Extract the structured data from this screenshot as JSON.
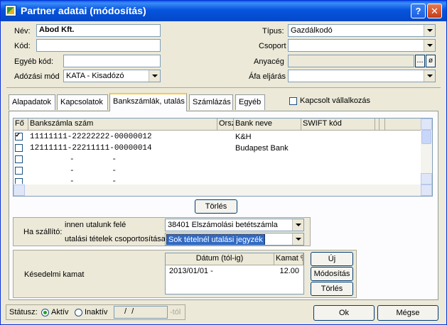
{
  "window": {
    "title": "Partner adatai (módosítás)",
    "help": "?",
    "close": "✕"
  },
  "form": {
    "nev_label": "Név:",
    "nev_value": "Abod Kft.",
    "kod_label": "Kód:",
    "kod_value": "",
    "egyeb_kod_label": "Egyéb kód:",
    "egyeb_kod_value": "",
    "adozasi_mod_label": "Adózási mód",
    "adozasi_mod_value": "KATA - Kisadózó",
    "tipus_label": "Típus:",
    "tipus_value": "Gazdálkodó",
    "csoport_label": "Csoport",
    "csoport_value": "",
    "anyaceg_label": "Anyacég",
    "anyaceg_value": "",
    "anyaceg_btn": "...",
    "anyaceg_clear": "ø",
    "afa_label": "Áfa eljárás",
    "afa_value": ""
  },
  "tabs": [
    "Alapadatok",
    "Kapcsolatok",
    "Bankszámlák, utalás",
    "Számlázás",
    "Egyéb"
  ],
  "kapcsolt_label": "Kapcsolt vállalkozás",
  "grid": {
    "headers": [
      "Fő",
      "Bankszámla szám",
      "Orsz",
      "Bank neve",
      "SWIFT kód"
    ],
    "rows": [
      {
        "fo": true,
        "szamla": "11111111-22222222-00000012",
        "bank": "K&H"
      },
      {
        "fo": false,
        "szamla": "12111111-22211111-00000014",
        "bank": "Budapest Bank"
      },
      {
        "fo": false,
        "szamla": "-        -",
        "bank": ""
      },
      {
        "fo": false,
        "szamla": "-        -",
        "bank": ""
      },
      {
        "fo": false,
        "szamla": "-        -",
        "bank": ""
      }
    ]
  },
  "torles_grid": "Törlés",
  "szallito": {
    "label": "Ha szállító:",
    "innen_label": "innen utalunk felé",
    "innen_value": "38401 Elszámolási betétszámla",
    "csop_label": "utalási tételek csoportosítása",
    "csop_value": "Sok tételnél utalási jegyzék"
  },
  "kesedelmi": {
    "label": "Késedelmi kamat",
    "col_datum": "Dátum (tól-ig)",
    "col_kamat": "Kamat %",
    "row_datum": "2013/01/01 -",
    "row_kamat": "12.00",
    "uj": "Új",
    "modositas": "Módosítás",
    "torles": "Törlés"
  },
  "status": {
    "label": "Státusz:",
    "aktiv": "Aktív",
    "inaktiv": "Inaktív",
    "date_value": "/ /",
    "tol": "-tól"
  },
  "buttons": {
    "ok": "Ok",
    "megse": "Mégse"
  }
}
